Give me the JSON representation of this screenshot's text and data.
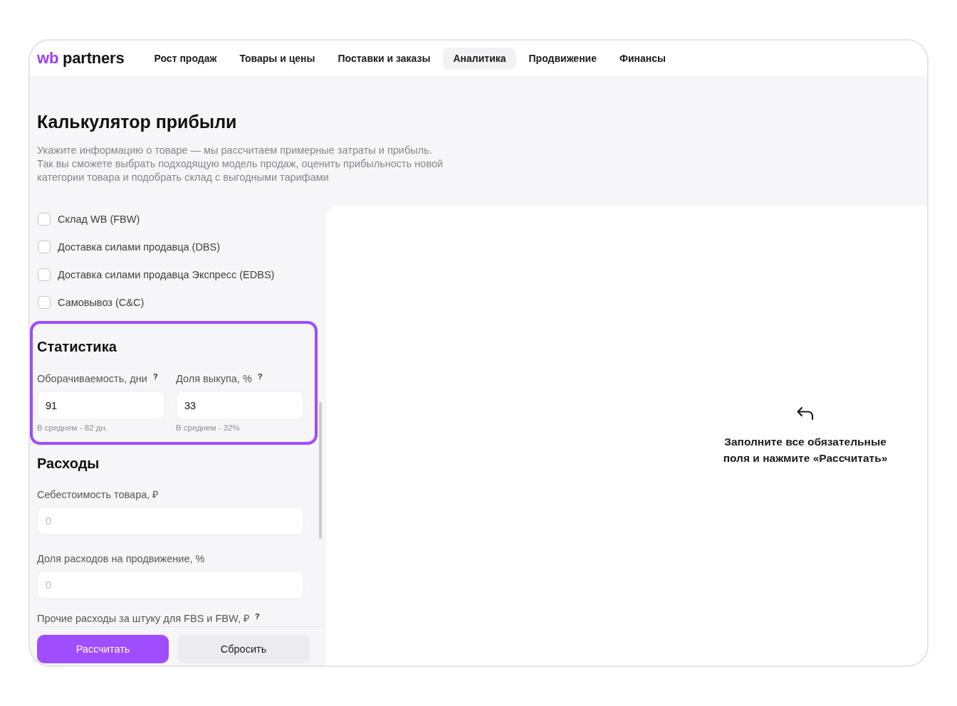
{
  "header": {
    "logo": {
      "mark": "wb",
      "text": "partners"
    },
    "nav": [
      {
        "label": "Рост продаж",
        "selected": false
      },
      {
        "label": "Товары и цены",
        "selected": false
      },
      {
        "label": "Поставки и заказы",
        "selected": false
      },
      {
        "label": "Аналитика",
        "selected": true
      },
      {
        "label": "Продвижение",
        "selected": false
      },
      {
        "label": "Финансы",
        "selected": false
      }
    ]
  },
  "page": {
    "title": "Калькулятор прибыли",
    "description": [
      "Укажите информацию о товаре — мы рассчитаем примерные затраты и прибыль.",
      "Так вы сможете выбрать подходящую модель продаж, оценить прибыльность новой категории товара и подобрать склад с выгодными тарифами"
    ]
  },
  "delivery_options": [
    {
      "label": "Склад WB (FBW)",
      "checked": false
    },
    {
      "label": "Доставка силами продавца (DBS)",
      "checked": false
    },
    {
      "label": "Доставка силами продавца Экспресс (EDBS)",
      "checked": false
    },
    {
      "label": "Самовывоз (C&C)",
      "checked": false
    }
  ],
  "statistics": {
    "highlighted": true,
    "title": "Статистика",
    "fields": [
      {
        "label": "Оборачиваемость, дни",
        "help": "?",
        "value": "91",
        "hint": "В среднем - 82 дн."
      },
      {
        "label": "Доля выкупа, %",
        "help": "?",
        "value": "33",
        "hint": "В среднем - 32%"
      }
    ]
  },
  "expenses": {
    "title": "Расходы",
    "fields": [
      {
        "label": "Себестоимость товара, ₽",
        "placeholder": "0"
      },
      {
        "label": "Доля расходов на продвижение, %",
        "placeholder": "0"
      },
      {
        "label": "Прочие расходы за штуку для FBS и FBW, ₽",
        "help": "?"
      }
    ]
  },
  "buttons": [
    {
      "label": "Рассчитать",
      "kind": "primary"
    },
    {
      "label": "Сбросить",
      "kind": "secondary"
    }
  ],
  "result": {
    "message": "Заполните все обязательные поля и нажмите «Рассчитать»"
  }
}
